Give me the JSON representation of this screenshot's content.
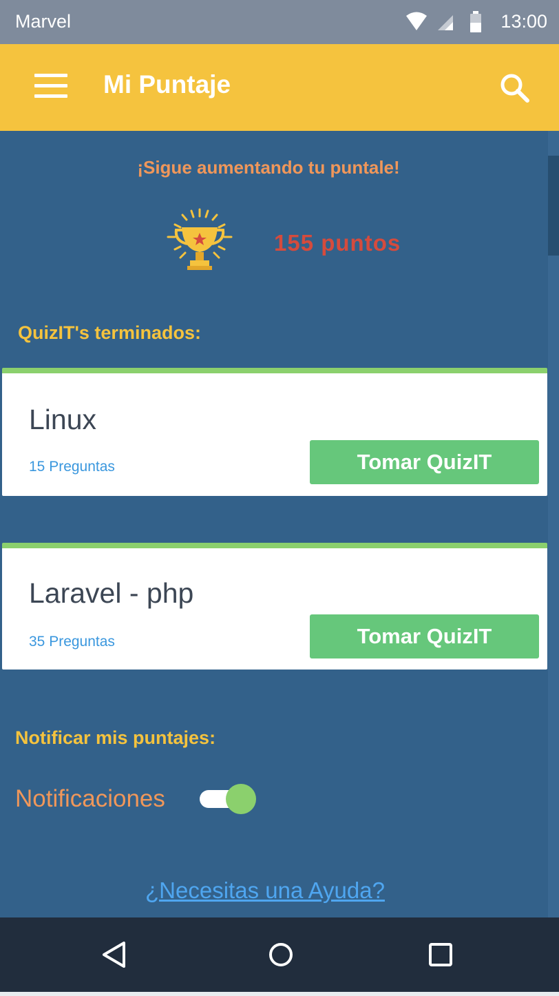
{
  "status_bar": {
    "carrier": "Marvel",
    "time": "13:00",
    "icons": [
      "wifi-icon",
      "signal-icon",
      "battery-icon"
    ]
  },
  "app_bar": {
    "title": "Mi Puntaje",
    "menu_icon": "hamburger-menu-icon",
    "search_icon": "search-icon"
  },
  "score": {
    "headline": "¡Sigue aumentando tu puntale!",
    "trophy_icon": "trophy-icon",
    "points_text": "155 puntos"
  },
  "finished_section": {
    "title": "QuizIT's terminados:",
    "quizzes": [
      {
        "name": "Linux",
        "questions": "15 Preguntas",
        "button_label": "Tomar QuizIT"
      },
      {
        "name": "Laravel - php",
        "questions": "35 Preguntas",
        "button_label": "Tomar QuizIT"
      }
    ]
  },
  "notifications_section": {
    "title": "Notificar mis puntajes:",
    "label": "Notificaciones",
    "enabled": true
  },
  "help_link": "¿Necesitas una Ayuda?",
  "nav_bar": {
    "icons": [
      "back-triangle-icon",
      "home-circle-icon",
      "recents-square-icon"
    ]
  },
  "colors": {
    "app_bar": "#f5c33e",
    "background": "#33618a",
    "accent_green": "#66c77b",
    "card_border": "#8bd06d",
    "orange_text": "#f0975a",
    "points_red": "#d54b3d",
    "link_blue": "#4fa6f0"
  }
}
